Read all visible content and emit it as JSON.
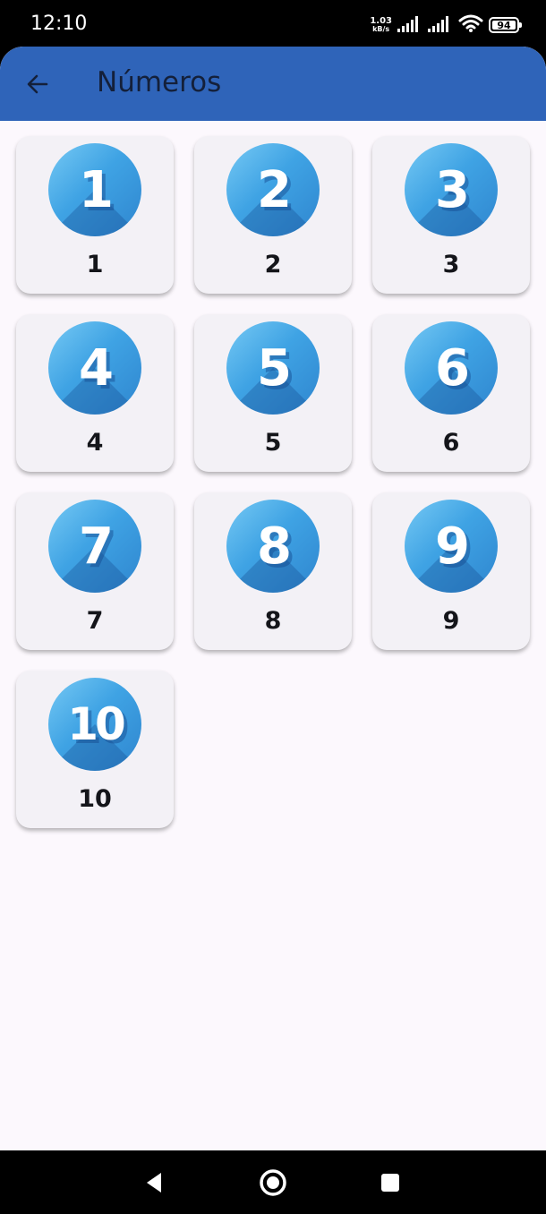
{
  "status_bar": {
    "time": "12:10",
    "net_speed_value": "1.03",
    "net_speed_unit": "kB/s",
    "battery_level": "94",
    "icons": [
      "signal-icon",
      "signal-icon",
      "wifi-icon",
      "battery-icon"
    ]
  },
  "app_bar": {
    "title": "Números",
    "back_icon": "arrow-left-icon",
    "color": "#2f64b9"
  },
  "numbers": {
    "items": [
      {
        "badge": "1",
        "label": "1"
      },
      {
        "badge": "2",
        "label": "2"
      },
      {
        "badge": "3",
        "label": "3"
      },
      {
        "badge": "4",
        "label": "4"
      },
      {
        "badge": "5",
        "label": "5"
      },
      {
        "badge": "6",
        "label": "6"
      },
      {
        "badge": "7",
        "label": "7"
      },
      {
        "badge": "8",
        "label": "8"
      },
      {
        "badge": "9",
        "label": "9"
      },
      {
        "badge": "10",
        "label": "10"
      }
    ],
    "badge_color": "#3fa3e4"
  },
  "nav_bar": {
    "buttons": [
      "triangle-back-icon",
      "circle-home-icon",
      "square-recents-icon"
    ]
  }
}
